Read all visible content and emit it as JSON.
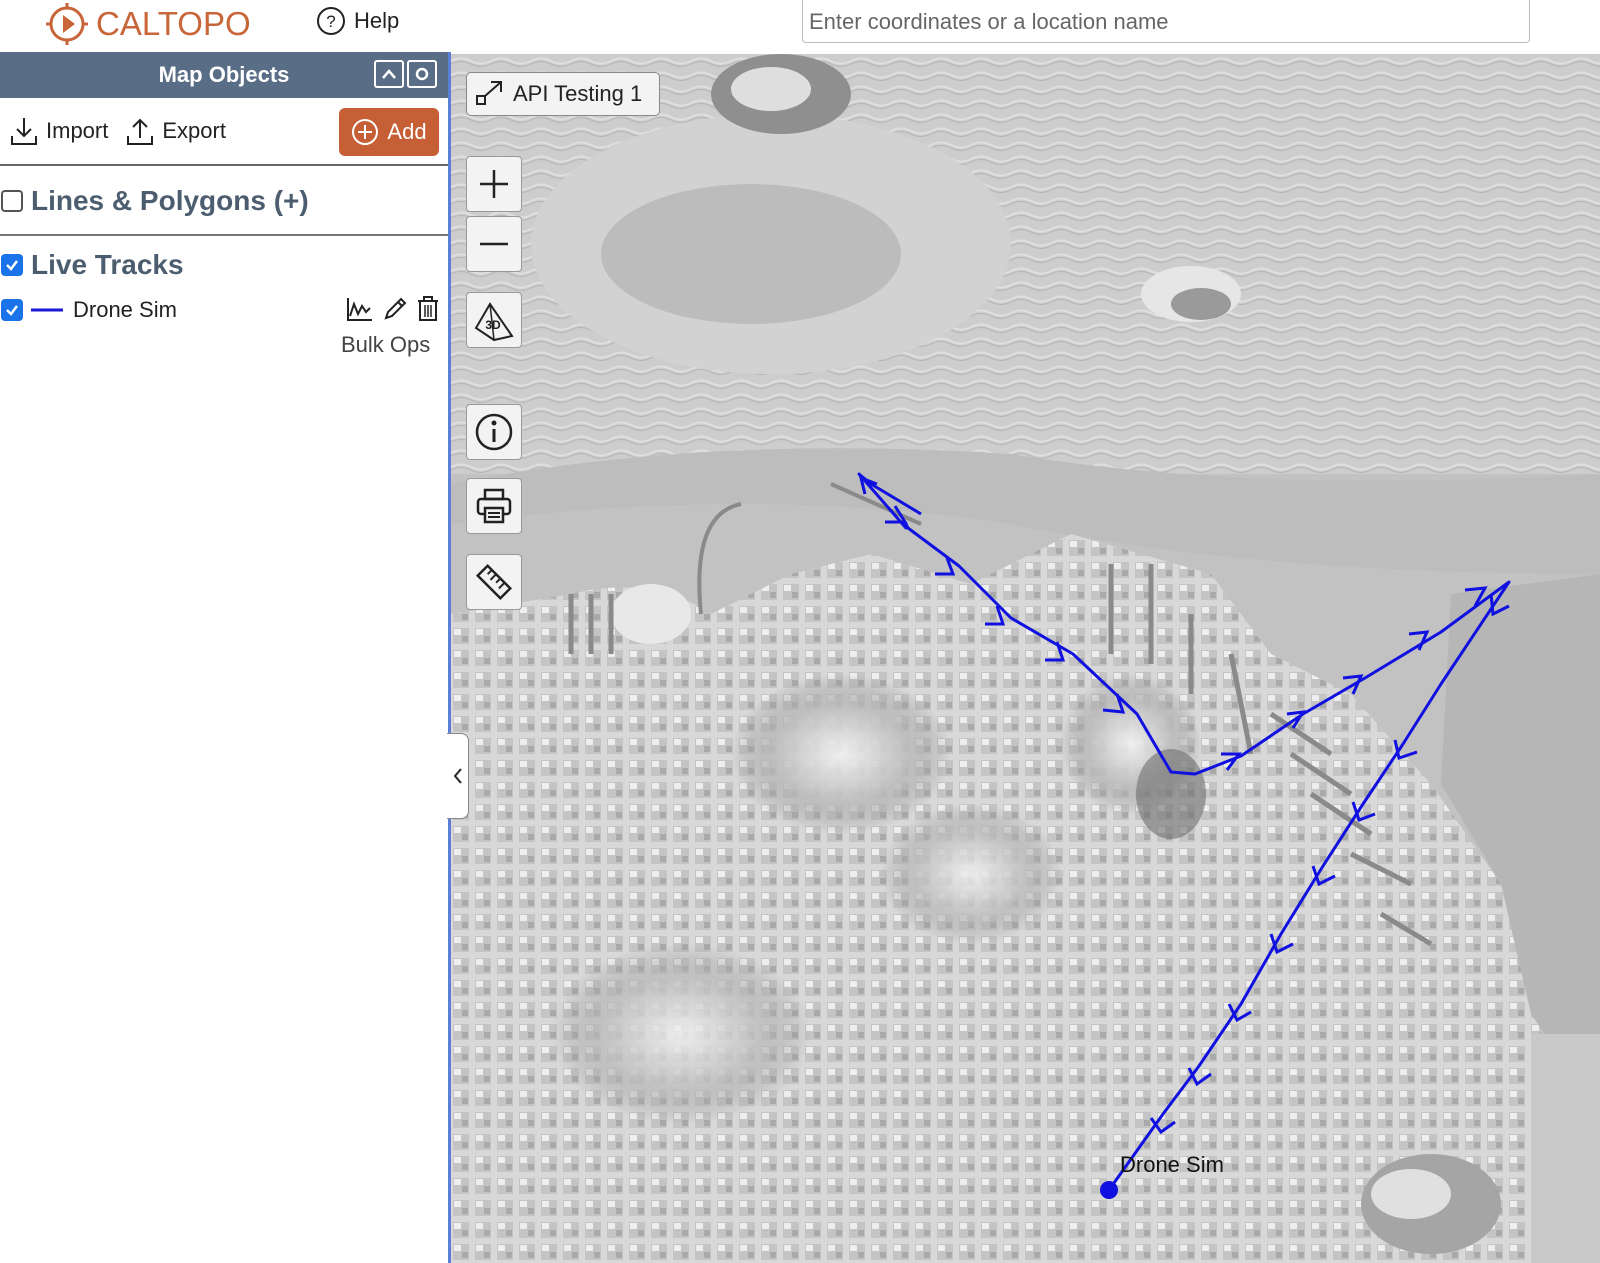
{
  "header": {
    "logo_text": "CALTOPO",
    "help_label": "Help",
    "search_placeholder": "Enter coordinates or a location name"
  },
  "sidebar": {
    "title": "Map Objects",
    "import_label": "Import",
    "export_label": "Export",
    "add_label": "Add",
    "lines_polygons_label": "Lines & Polygons (+)",
    "lines_polygons_checked": false,
    "live_tracks_label": "Live Tracks",
    "live_tracks_checked": true,
    "tracks": [
      {
        "label": "Drone Sim",
        "checked": true,
        "color": "#1a1ad6"
      }
    ],
    "bulk_ops_label": "Bulk Ops"
  },
  "map": {
    "map_title": "API Testing 1",
    "track_label": "Drone Sim",
    "track_color": "#1010e0",
    "controls": [
      "zoom-in-icon",
      "zoom-out-icon",
      "3d-icon",
      "info-icon",
      "print-icon",
      "ruler-icon"
    ]
  },
  "colors": {
    "brand": "#c8663a",
    "header_bg": "#5a6d86",
    "add_button": "#c65f36",
    "checkbox": "#1a73e8",
    "sidebar_border": "#5b7fd6"
  }
}
